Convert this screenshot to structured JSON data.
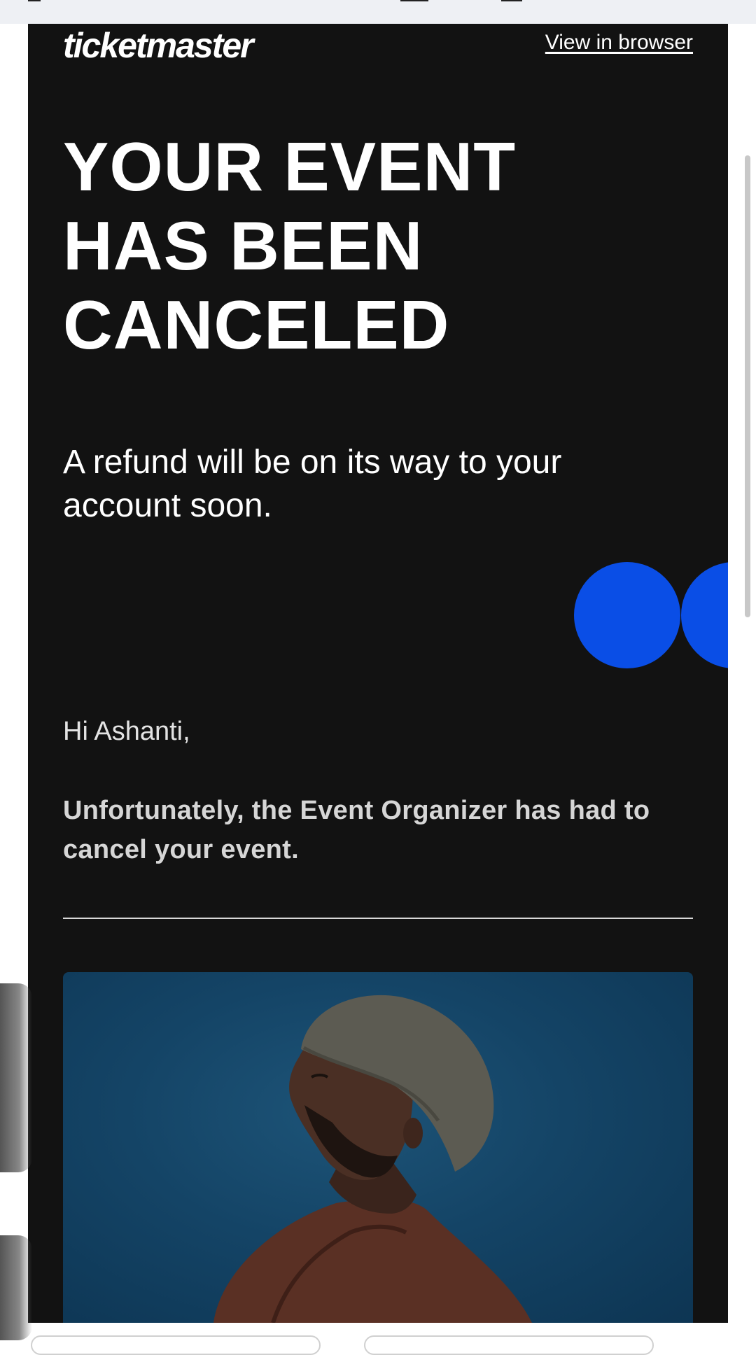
{
  "header": {
    "logo_text": "ticketmaster",
    "view_in_browser": "View in browser"
  },
  "hero": {
    "headline": "YOUR EVENT\nHAS BEEN\nCANCELED",
    "refund_text": "A refund will be on its way to your account soon."
  },
  "body": {
    "greeting": "Hi Ashanti,",
    "notice": "Unfortunately, the Event Organizer has had to cancel your event."
  },
  "event_image": {
    "description_icon": "artist-photo"
  },
  "colors": {
    "email_background": "#121212",
    "accent_blue": "#0a4ee6",
    "text_white": "#ffffff",
    "photo_blue": "#144466",
    "page_background": "#ffffff"
  }
}
